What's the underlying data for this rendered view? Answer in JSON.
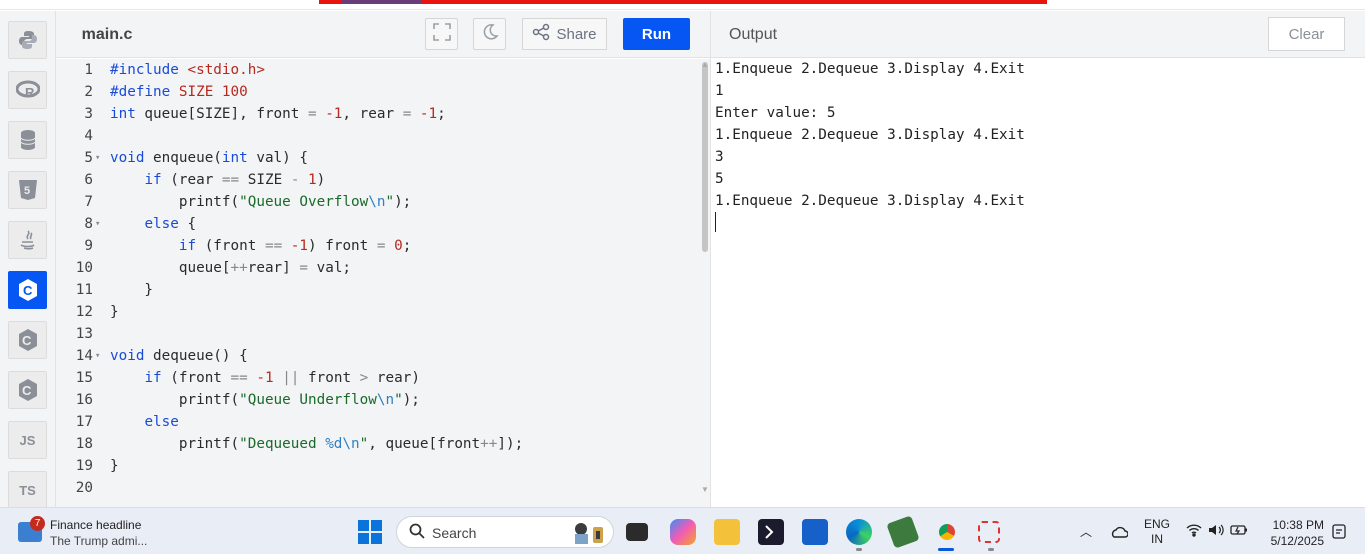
{
  "colors": {
    "accent": "#0556f3",
    "editor_bg": "#f3f4f6",
    "keyword": "#1a4bd6",
    "string": "#1a6a2a",
    "number": "#b52a1d"
  },
  "sidebar": {
    "languages": [
      {
        "name": "python-icon",
        "label": ""
      },
      {
        "name": "r-icon",
        "label": "R"
      },
      {
        "name": "sql-icon",
        "label": ""
      },
      {
        "name": "html-icon",
        "label": "5"
      },
      {
        "name": "java-icon",
        "label": ""
      },
      {
        "name": "c-icon",
        "label": "C",
        "active": true
      },
      {
        "name": "cpp-icon",
        "label": "C"
      },
      {
        "name": "csharp-icon",
        "label": "C"
      },
      {
        "name": "js-icon",
        "label": "JS"
      },
      {
        "name": "ts-icon",
        "label": "TS"
      }
    ]
  },
  "editor": {
    "file_tab": "main.c",
    "share_label": "Share",
    "run_label": "Run",
    "line_numbers": [
      "1",
      "2",
      "3",
      "4",
      "5",
      "6",
      "7",
      "8",
      "9",
      "10",
      "11",
      "12",
      "13",
      "14",
      "15",
      "16",
      "17",
      "18",
      "19",
      "20"
    ],
    "code_lines": [
      "#include <stdio.h>",
      "#define SIZE 100",
      "int queue[SIZE], front = -1, rear = -1;",
      "",
      "void enqueue(int val) {",
      "    if (rear == SIZE - 1)",
      "        printf(\"Queue Overflow\\n\");",
      "    else {",
      "        if (front == -1) front = 0;",
      "        queue[++rear] = val;",
      "    }",
      "}",
      "",
      "void dequeue() {",
      "    if (front == -1 || front > rear)",
      "        printf(\"Queue Underflow\\n\");",
      "    else",
      "        printf(\"Dequeued %d\\n\", queue[front++]);",
      "}",
      ""
    ]
  },
  "output": {
    "title": "Output",
    "clear_label": "Clear",
    "lines": [
      "1.Enqueue 2.Dequeue 3.Display 4.Exit",
      "1",
      "Enter value: 5",
      "1.Enqueue 2.Dequeue 3.Display 4.Exit",
      "3",
      "5",
      "1.Enqueue 2.Dequeue 3.Display 4.Exit"
    ]
  },
  "taskbar": {
    "news_badge": "7",
    "news_title": "Finance headline",
    "news_subtitle": "The Trump admi...",
    "search_placeholder": "Search",
    "lang_line1": "ENG",
    "lang_line2": "IN",
    "time": "10:38 PM",
    "date": "5/12/2025"
  }
}
